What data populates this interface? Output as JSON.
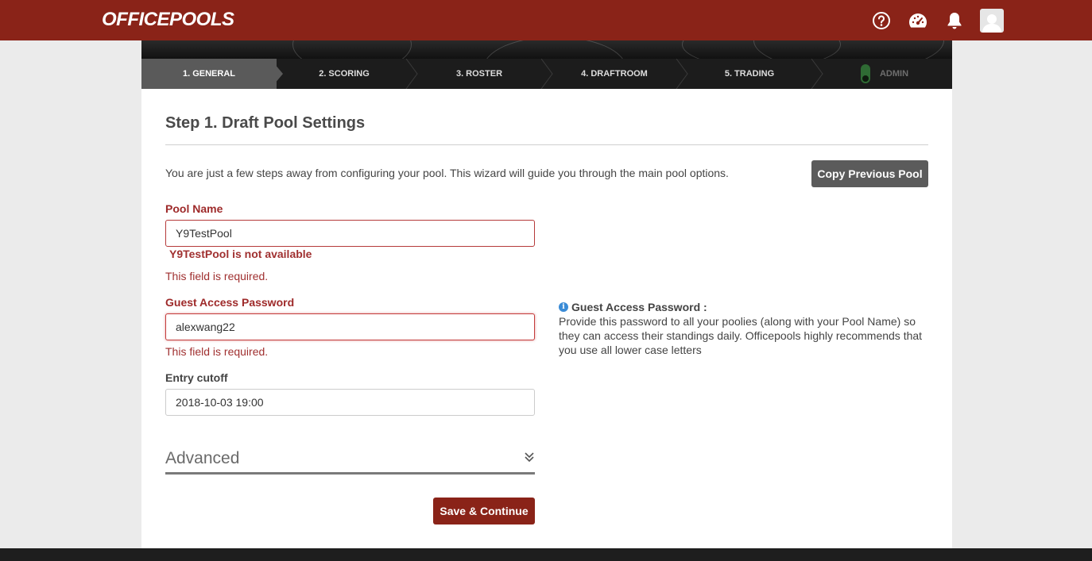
{
  "header": {
    "logo": "OFFICEPOOLS",
    "icons": [
      "help-icon",
      "dashboard-icon",
      "bell-icon",
      "avatar-icon"
    ]
  },
  "wizard": {
    "steps": [
      {
        "label": "1. GENERAL",
        "active": true
      },
      {
        "label": "2. SCORING",
        "active": false
      },
      {
        "label": "3. ROSTER",
        "active": false
      },
      {
        "label": "4. DRAFTROOM",
        "active": false
      },
      {
        "label": "5. TRADING",
        "active": false
      },
      {
        "label": "ADMIN",
        "active": false
      }
    ]
  },
  "form": {
    "title": "Step 1. Draft Pool Settings",
    "intro": "You are just a few steps away from configuring your pool. This wizard will guide you through the main pool options.",
    "copy_button": "Copy Previous Pool",
    "pool_name": {
      "label": "Pool Name",
      "value": "Y9TestPool",
      "availability_error": "Y9TestPool is not available",
      "required_error": "This field is required."
    },
    "guest_password": {
      "label": "Guest Access Password",
      "value": "alexwang22",
      "required_error": "This field is required."
    },
    "entry_cutoff": {
      "label": "Entry cutoff",
      "value": "2018-10-03 19:00"
    },
    "advanced_label": "Advanced",
    "save_button": "Save & Continue"
  },
  "help": {
    "title": "Guest Access Password :",
    "body": "Provide this password to all your poolies (along with your Pool Name) so they can access their standings daily. Officepools highly recommends that you use all lower case letters"
  },
  "colors": {
    "brand": "#8a2318",
    "error": "#9e2a2a",
    "active_step": "#5a5a5a"
  }
}
